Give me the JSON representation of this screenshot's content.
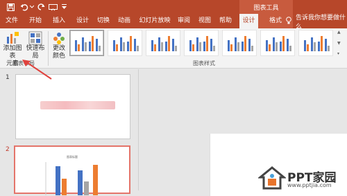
{
  "quick_access": {
    "save_icon": "save-icon",
    "undo_icon": "undo-icon",
    "redo_icon": "redo-icon",
    "present_icon": "present-from-start-icon",
    "more_icon": "chevron-down-icon"
  },
  "contextual": {
    "label": "图表工具"
  },
  "tabs": [
    {
      "label": "文件",
      "active": false
    },
    {
      "label": "开始",
      "active": false
    },
    {
      "label": "插入",
      "active": false
    },
    {
      "label": "设计",
      "active": false
    },
    {
      "label": "切换",
      "active": false
    },
    {
      "label": "动画",
      "active": false
    },
    {
      "label": "幻灯片放映",
      "active": false
    },
    {
      "label": "审阅",
      "active": false
    },
    {
      "label": "视图",
      "active": false
    },
    {
      "label": "帮助",
      "active": false
    },
    {
      "label": "设计",
      "active": true
    },
    {
      "label": "格式",
      "active": false
    }
  ],
  "tell_me": {
    "icon": "lightbulb-icon",
    "text": "告诉我你想要做什么"
  },
  "ribbon": {
    "add_element": {
      "line1": "添加图表",
      "line2": "元素"
    },
    "quick_layout": {
      "label": "快速布局"
    },
    "change_colors": {
      "line1": "更改",
      "line2": "颜色"
    },
    "group_layout": "图表布局",
    "group_styles": "图表样式"
  },
  "slides": {
    "first_number": "1",
    "second_number": "2",
    "mini_chart_title": "图表标题"
  },
  "watermark": {
    "text": "PPT家园",
    "url": "www.pptjia.com"
  },
  "colors": {
    "accent": "#b7472a",
    "chart_blue": "#4472c4",
    "chart_orange": "#ed7d31",
    "chart_gray": "#a5a5a5"
  }
}
